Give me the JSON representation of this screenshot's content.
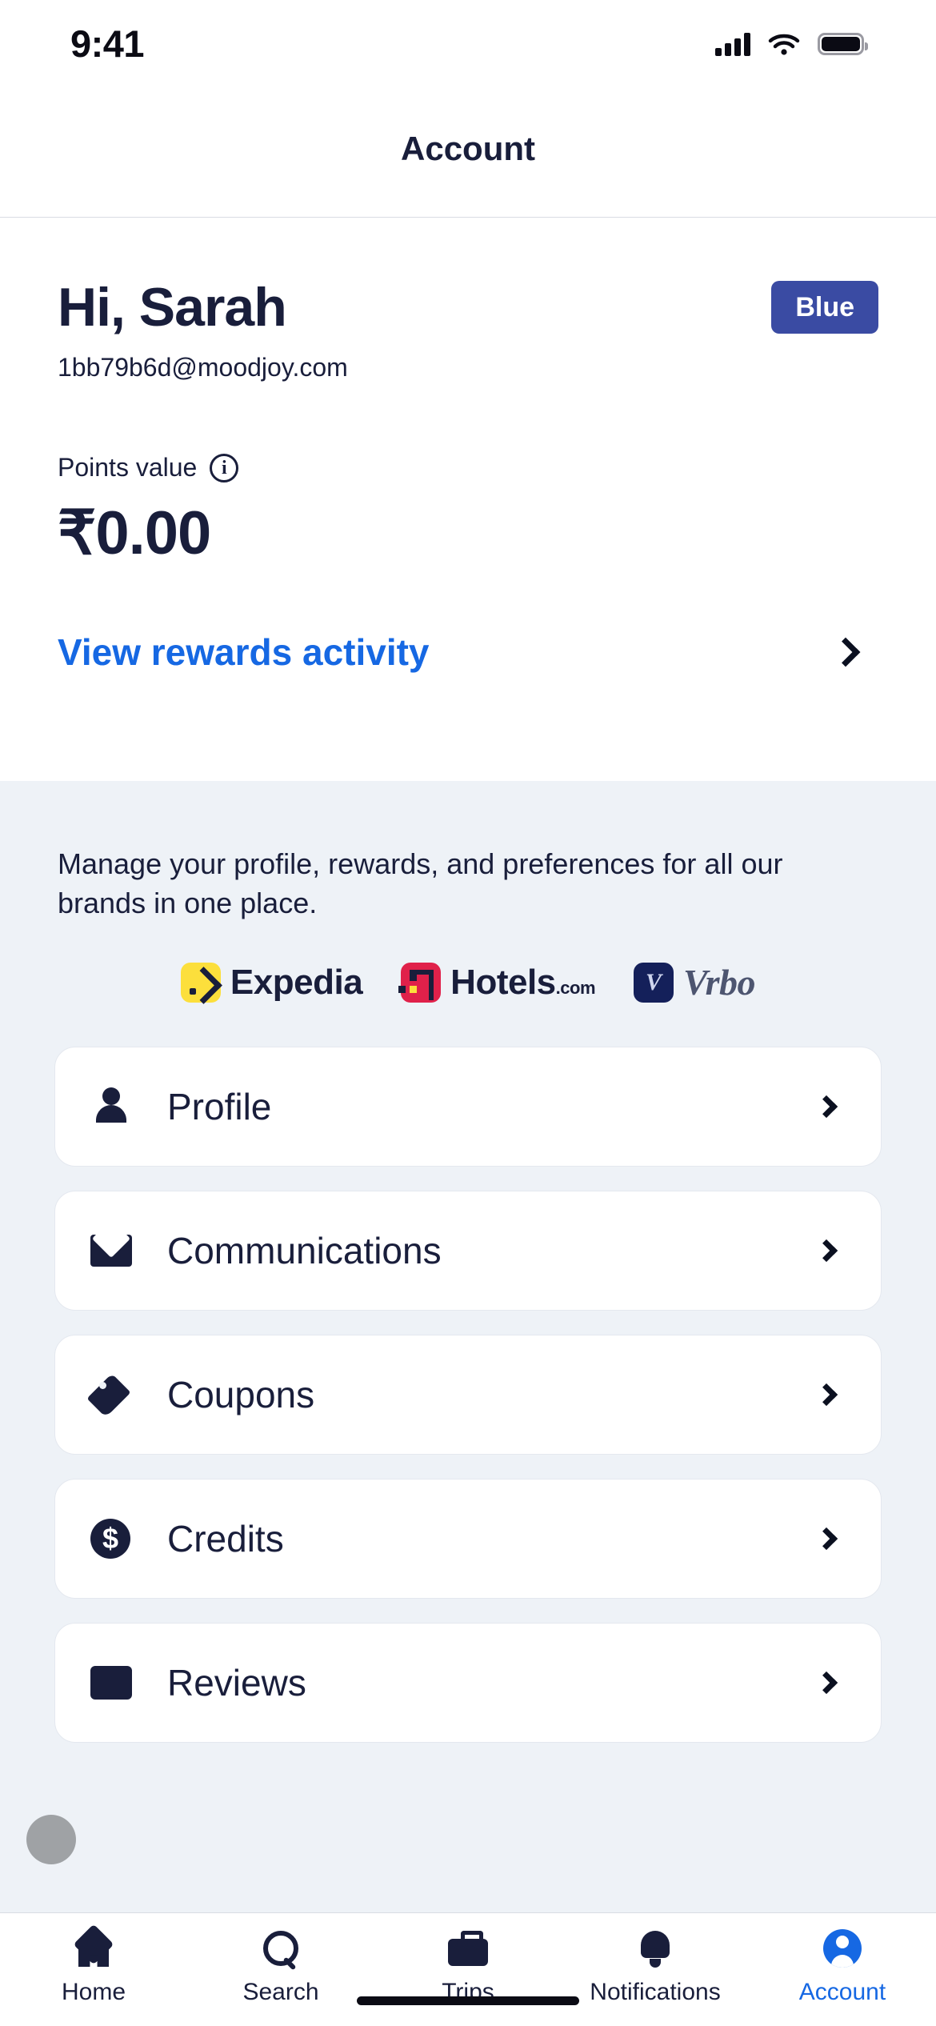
{
  "status_bar": {
    "time": "9:41",
    "signal_icon": "cellular-bars-icon",
    "wifi_icon": "wifi-icon",
    "battery_icon": "battery-icon"
  },
  "header": {
    "title": "Account"
  },
  "hero": {
    "greeting": "Hi, Sarah",
    "email": "1bb79b6d@moodjoy.com",
    "tier_badge": "Blue",
    "points_label": "Points value",
    "info_icon": "info-circle-icon",
    "points_amount": "₹0.00",
    "rewards_link": "View rewards activity",
    "rewards_chevron": "chevron-right-icon"
  },
  "panel": {
    "description": "Manage your profile, rewards, and preferences for all our brands in one place.",
    "brands": [
      {
        "name": "Expedia",
        "tld": "",
        "mark": "expedia-logo-icon"
      },
      {
        "name": "Hotels",
        "tld": ".com",
        "mark": "hotels-logo-icon"
      },
      {
        "name": "Vrbo",
        "tld": "",
        "mark": "vrbo-logo-icon"
      }
    ],
    "menu": [
      {
        "label": "Profile",
        "icon": "person-icon"
      },
      {
        "label": "Communications",
        "icon": "envelope-icon"
      },
      {
        "label": "Coupons",
        "icon": "tag-icon"
      },
      {
        "label": "Credits",
        "icon": "dollar-circle-icon"
      },
      {
        "label": "Reviews",
        "icon": "document-icon"
      }
    ]
  },
  "tabbar": {
    "items": [
      {
        "label": "Home",
        "icon": "home-icon",
        "active": false
      },
      {
        "label": "Search",
        "icon": "search-icon",
        "active": false
      },
      {
        "label": "Trips",
        "icon": "briefcase-icon",
        "active": false
      },
      {
        "label": "Notifications",
        "icon": "bell-icon",
        "active": false
      },
      {
        "label": "Account",
        "icon": "account-avatar-icon",
        "active": true
      }
    ]
  },
  "colors": {
    "accent_blue": "#1668e3",
    "tier_badge_bg": "#3a4ba3",
    "text_dark": "#191e3b",
    "panel_bg": "#eef2f7",
    "expedia_yellow": "#fcdf3c",
    "hotels_red": "#e0214a",
    "vrbo_navy": "#14205a"
  }
}
